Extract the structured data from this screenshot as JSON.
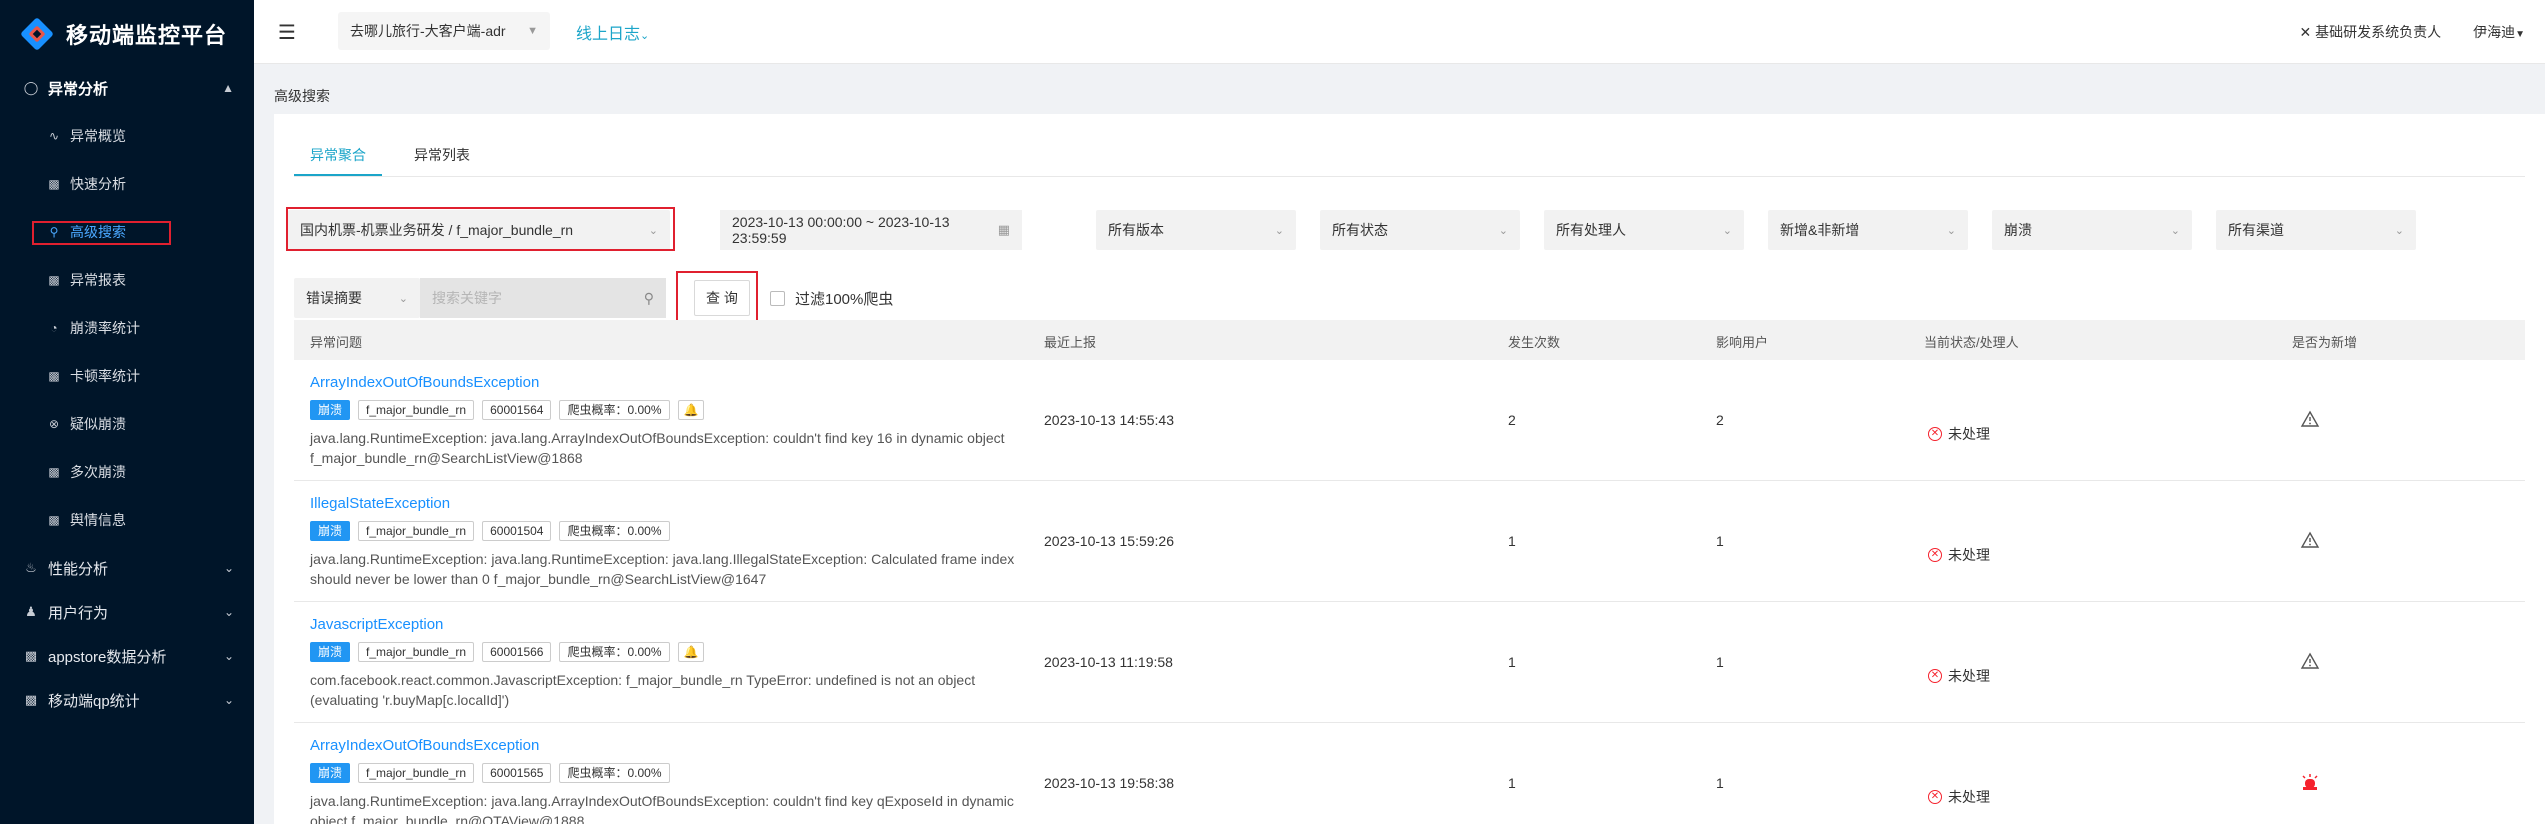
{
  "app": {
    "title": "移动端监控平台",
    "selected_app": "去哪儿旅行-大客户端-adr",
    "log_link": "线上日志",
    "role": "基础研发系统负责人",
    "user": "伊海迪"
  },
  "sidebar": {
    "groups": [
      {
        "label": "异常分析",
        "icon": "bulb-icon",
        "expanded": true
      },
      {
        "label": "性能分析",
        "icon": "bell-icon",
        "expanded": false
      },
      {
        "label": "用户行为",
        "icon": "user-icon",
        "expanded": false
      },
      {
        "label": "appstore数据分析",
        "icon": "chart-icon",
        "expanded": false
      },
      {
        "label": "移动端qp统计",
        "icon": "chart-icon",
        "expanded": false
      }
    ],
    "items": [
      {
        "label": "异常概览",
        "icon": "line-chart-icon"
      },
      {
        "label": "快速分析",
        "icon": "bar-chart-icon"
      },
      {
        "label": "高级搜索",
        "icon": "search-icon",
        "active": true
      },
      {
        "label": "异常报表",
        "icon": "bar-chart-icon"
      },
      {
        "label": "崩溃率统计",
        "icon": "pie-chart-icon"
      },
      {
        "label": "卡顿率统计",
        "icon": "bar-chart-icon"
      },
      {
        "label": "疑似崩溃",
        "icon": "close-circle-icon"
      },
      {
        "label": "多次崩溃",
        "icon": "bar-chart-icon"
      },
      {
        "label": "舆情信息",
        "icon": "bar-chart-icon"
      }
    ]
  },
  "breadcrumb": "高级搜索",
  "tabs": [
    {
      "label": "异常聚合",
      "active": true
    },
    {
      "label": "异常列表",
      "active": false
    }
  ],
  "filters": {
    "bundle": "国内机票-机票业务研发 / f_major_bundle_rn",
    "date_range": "2023-10-13 00:00:00 ~ 2023-10-13 23:59:59",
    "version": "所有版本",
    "status": "所有状态",
    "handler": "所有处理人",
    "new_type": "新增&非新增",
    "type": "崩溃",
    "channel": "所有渠道",
    "search_field": "错误摘要",
    "search_placeholder": "搜索关键字",
    "query_button": "查 询",
    "filter_crawler": "过滤100%爬虫"
  },
  "table": {
    "columns": [
      "异常问题",
      "最近上报",
      "发生次数",
      "影响用户",
      "当前状态/处理人",
      "是否为新增"
    ],
    "rows": [
      {
        "title": "ArrayIndexOutOfBoundsException",
        "tag_type": "崩溃",
        "bundle": "f_major_bundle_rn",
        "code": "60001564",
        "crawler": "爬虫概率：0.00%",
        "has_bell": true,
        "desc": "java.lang.RuntimeException: java.lang.ArrayIndexOutOfBoundsException: couldn't find key 16 in dynamic object f_major_bundle_rn@SearchListView@1868",
        "last_report": "2023-10-13 14:55:43",
        "count": "2",
        "users": "2",
        "status": "未处理",
        "is_new": false
      },
      {
        "title": "IllegalStateException",
        "tag_type": "崩溃",
        "bundle": "f_major_bundle_rn",
        "code": "60001504",
        "crawler": "爬虫概率：0.00%",
        "has_bell": false,
        "desc": "java.lang.RuntimeException: java.lang.RuntimeException: java.lang.IllegalStateException: Calculated frame index should never be lower than 0 f_major_bundle_rn@SearchListView@1647",
        "last_report": "2023-10-13 15:59:26",
        "count": "1",
        "users": "1",
        "status": "未处理",
        "is_new": false
      },
      {
        "title": "JavascriptException",
        "tag_type": "崩溃",
        "bundle": "f_major_bundle_rn",
        "code": "60001566",
        "crawler": "爬虫概率：0.00%",
        "has_bell": true,
        "desc": "com.facebook.react.common.JavascriptException: f_major_bundle_rn TypeError: undefined is not an object (evaluating 'r.buyMap[c.localId]')",
        "last_report": "2023-10-13 11:19:58",
        "count": "1",
        "users": "1",
        "status": "未处理",
        "is_new": false
      },
      {
        "title": "ArrayIndexOutOfBoundsException",
        "tag_type": "崩溃",
        "bundle": "f_major_bundle_rn",
        "code": "60001565",
        "crawler": "爬虫概率：0.00%",
        "has_bell": false,
        "desc": "java.lang.RuntimeException: java.lang.ArrayIndexOutOfBoundsException: couldn't find key qExposeId in dynamic object f_major_bundle_rn@OTAView@1888",
        "last_report": "2023-10-13 19:58:38",
        "count": "1",
        "users": "1",
        "status": "未处理",
        "is_new": true
      }
    ]
  },
  "colors": {
    "sidebar_bg": "#001529",
    "accent": "#1ba5c9",
    "link": "#1890ff",
    "highlight_box": "#e0202f",
    "new_flag": "#f5222d"
  }
}
